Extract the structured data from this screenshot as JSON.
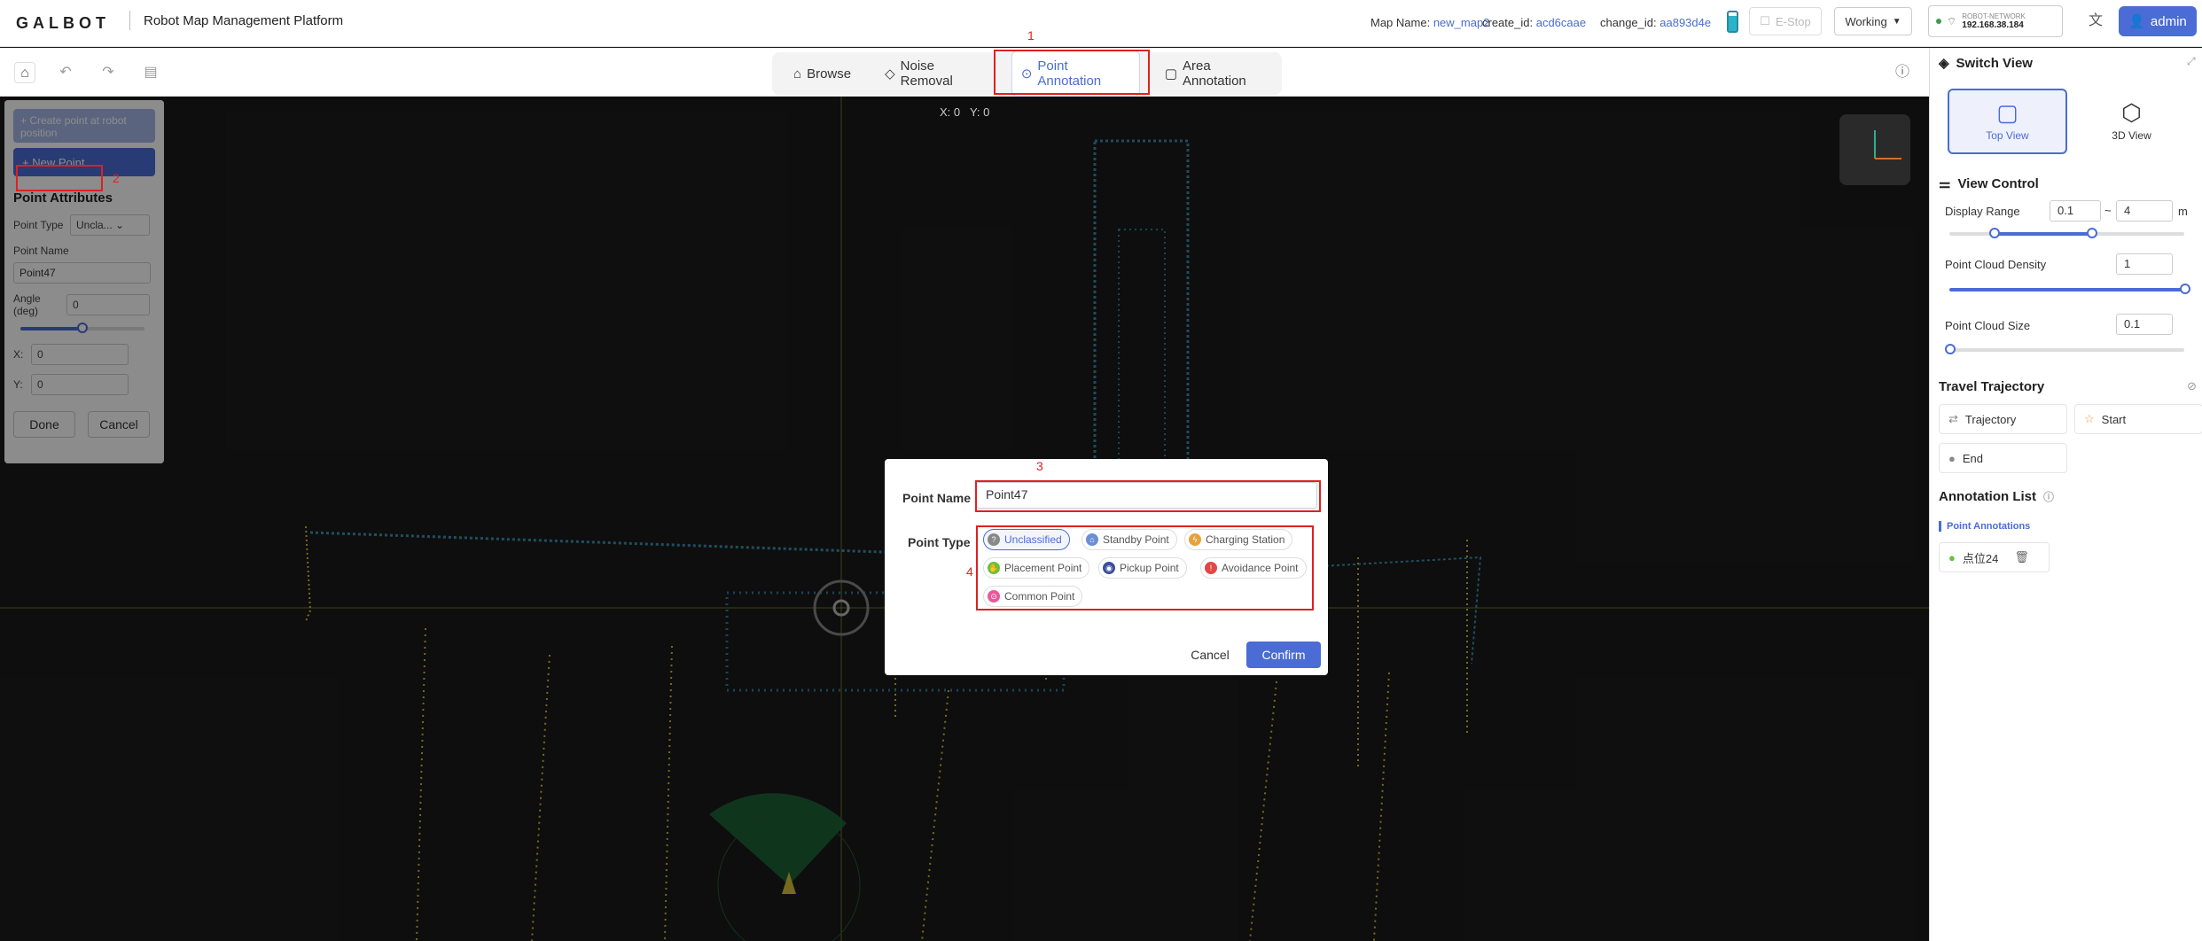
{
  "header": {
    "logo": "GALBOT",
    "title": "Robot Map Management Platform",
    "map_name_label": "Map Name:",
    "map_name": "new_map2",
    "create_id_label": "create_id:",
    "create_id": "acd6caae",
    "change_id_label": "change_id:",
    "change_id": "aa893d4e",
    "estop": "E-Stop",
    "status": "Working",
    "network_ssid": "ROBOT-NETWORK",
    "network_ip": "192.168.38.184",
    "user": "admin"
  },
  "tabs": [
    {
      "label": "Browse"
    },
    {
      "label": "Noise Removal"
    },
    {
      "label": "Point Annotation"
    },
    {
      "label": "Area Annotation"
    }
  ],
  "map": {
    "coords_x": "X: 0",
    "coords_y": "Y: 0"
  },
  "left_panel": {
    "create_at_robot": "Create point at robot position",
    "new_point": "New Point",
    "attributes_title": "Point Attributes",
    "point_type_label": "Point Type",
    "point_type_value": "Uncla...",
    "point_name_label": "Point Name",
    "point_name_value": "Point47",
    "angle_label": "Angle (deg)",
    "angle_value": "0",
    "x_label": "X:",
    "x_value": "0",
    "y_label": "Y:",
    "y_value": "0",
    "done": "Done",
    "cancel": "Cancel"
  },
  "right_panel": {
    "switch_view": "Switch View",
    "top_view": "Top View",
    "view_3d": "3D View",
    "view_control": "View Control",
    "display_range_label": "Display Range",
    "range_min": "0.1",
    "range_sep": "~",
    "range_max": "4",
    "range_unit": "m",
    "density_label": "Point Cloud Density",
    "density_value": "1",
    "size_label": "Point Cloud Size",
    "size_value": "0.1",
    "trajectory_title": "Travel Trajectory",
    "trajectory": "Trajectory",
    "start": "Start",
    "end": "End",
    "annotation_list": "Annotation List",
    "point_annotations": "Point Annotations",
    "annotation_item": "点位24"
  },
  "modal": {
    "name_label": "Point Name",
    "name_value": "Point47",
    "type_label": "Point Type",
    "options": [
      {
        "label": "Unclassified",
        "color": "#888888"
      },
      {
        "label": "Standby Point",
        "color": "#6b8fd6"
      },
      {
        "label": "Charging Station",
        "color": "#e6a23c"
      },
      {
        "label": "Placement Point",
        "color": "#67c23a"
      },
      {
        "label": "Pickup Point",
        "color": "#3a4fa0"
      },
      {
        "label": "Avoidance Point",
        "color": "#e04848"
      },
      {
        "label": "Common Point",
        "color": "#e85a9b"
      }
    ],
    "cancel": "Cancel",
    "confirm": "Confirm"
  },
  "annotations": {
    "n1": "1",
    "n2": "2",
    "n3": "3",
    "n4": "4"
  }
}
